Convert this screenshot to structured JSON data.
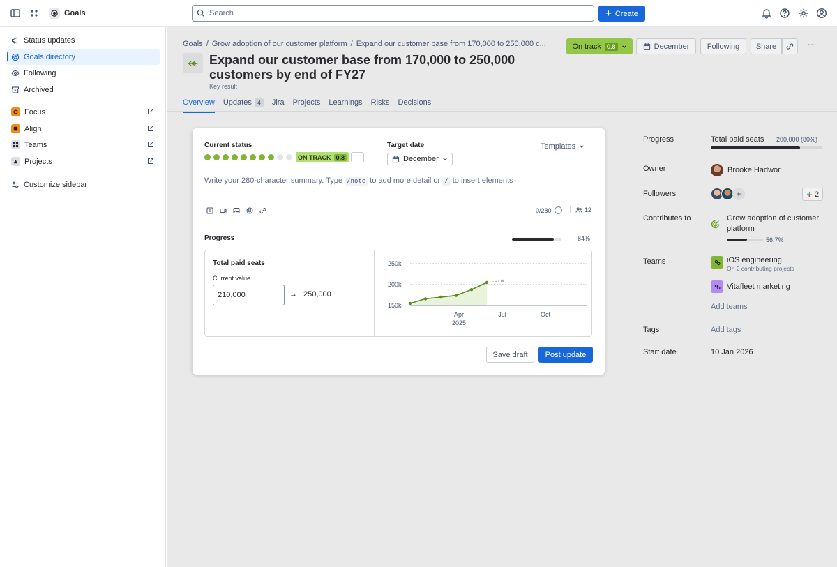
{
  "topbar": {
    "app_name": "Goals",
    "search_placeholder": "Search",
    "create_label": "Create"
  },
  "sidebar": {
    "items": [
      {
        "label": "Status updates",
        "icon": "megaphone-icon"
      },
      {
        "label": "Goals directory",
        "icon": "goal-icon",
        "active": true
      },
      {
        "label": "Following",
        "icon": "eye-icon"
      },
      {
        "label": "Archived",
        "icon": "archive-icon"
      }
    ],
    "apps": [
      {
        "label": "Focus",
        "color": "#f18d13"
      },
      {
        "label": "Align",
        "color": "#f18d13"
      },
      {
        "label": "Teams",
        "color": "#dcdfe4"
      },
      {
        "label": "Projects",
        "color": "#dcdfe4"
      }
    ],
    "customize_label": "Customize sidebar"
  },
  "header": {
    "breadcrumbs": [
      "Goals",
      "Grow adoption of our customer platform",
      "Expand our customer base from 170,000 to 250,000 c..."
    ],
    "title": "Expand our customer base from 170,000 to 250,000 customers by end of FY27",
    "type_label": "Key result",
    "status_label": "On track",
    "status_score": "0.8",
    "date_label": "December",
    "following_label": "Following",
    "share_label": "Share"
  },
  "tabs": [
    {
      "label": "Overview",
      "active": true
    },
    {
      "label": "Updates",
      "count": "4"
    },
    {
      "label": "Jira"
    },
    {
      "label": "Projects"
    },
    {
      "label": "Learnings"
    },
    {
      "label": "Risks"
    },
    {
      "label": "Decisions"
    }
  ],
  "update_card": {
    "current_status_label": "Current status",
    "status_dots_total": 10,
    "status_dots_filled": 8,
    "status_lozenge": "ON TRACK",
    "status_score": "0.8",
    "more_label": "···",
    "target_date_label": "Target date",
    "target_date_value": "December",
    "templates_label": "Templates",
    "summary_part1": "Write your 280-character summary. Type",
    "summary_code1": "/note",
    "summary_part2": "to add more detail or",
    "summary_code2": "/",
    "summary_part3": "to insert elements",
    "char_count": "0/280",
    "people_count": "12",
    "progress_label": "Progress",
    "progress_pct_text": "84%",
    "progress_fraction": 0.84,
    "metric_name": "Total paid seats",
    "current_value_label": "Current value",
    "current_value": "210,000",
    "target_value": "250,000",
    "save_draft_label": "Save draft",
    "post_update_label": "Post update"
  },
  "chart_data": {
    "type": "line",
    "y_ticks": [
      "250k",
      "200k",
      "150k"
    ],
    "x_ticks": [
      {
        "label": "Apr",
        "sublabel": "2025"
      },
      {
        "label": "Jul",
        "sublabel": ""
      },
      {
        "label": "Oct",
        "sublabel": ""
      }
    ],
    "ylim": [
      150000,
      250000
    ],
    "series": [
      {
        "values": [
          155000,
          166000,
          170000,
          174000,
          188000,
          205000
        ],
        "style": "solid",
        "color": "#5b8a1f"
      },
      {
        "values": [
          205000,
          209000
        ],
        "style": "dashed",
        "color": "#a5adba"
      }
    ]
  },
  "panel": {
    "progress_label": "Progress",
    "progress_metric": "Total paid seats",
    "progress_value": "200,000 (80%)",
    "progress_fraction": 0.8,
    "owner_label": "Owner",
    "owner_name": "Brooke Hadwor",
    "followers_label": "Followers",
    "followers_add": "+",
    "slack_count": "2",
    "contributes_label": "Contributes to",
    "contributes_goal": "Grow adoption of customer platform",
    "contributes_pct": "56.7%",
    "contributes_fraction": 0.567,
    "teams_label": "Teams",
    "teams": [
      {
        "name": "iOS engineering",
        "sub": "On 2 contributing projects",
        "color": "#82b536"
      },
      {
        "name": "Vitafleet marketing",
        "sub": "",
        "color": "#b38cf0"
      }
    ],
    "add_teams": "Add teams",
    "tags_label": "Tags",
    "add_tags": "Add tags",
    "start_date_label": "Start date",
    "start_date": "10 Jan 2026"
  }
}
